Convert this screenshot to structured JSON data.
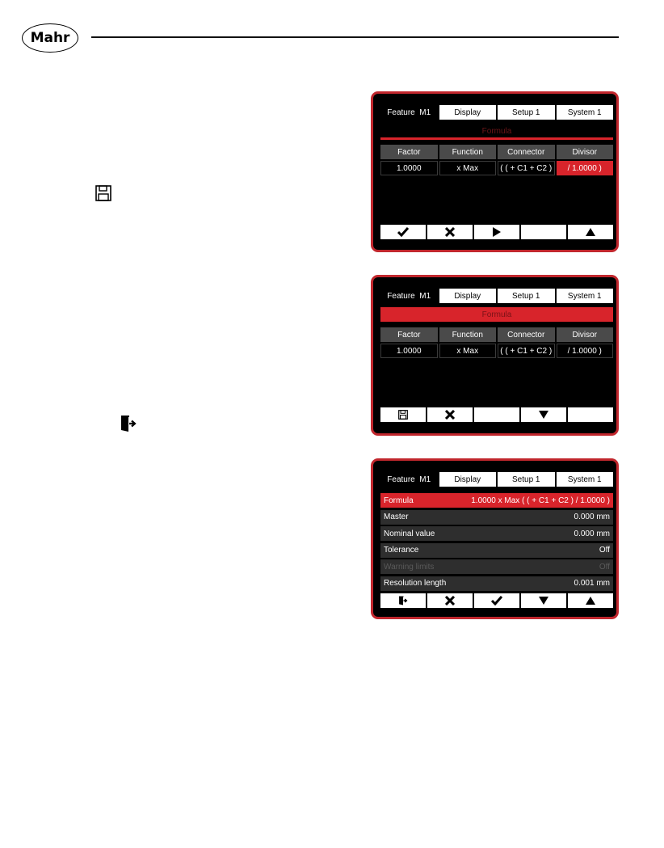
{
  "header": {
    "logo": "Mahr"
  },
  "side_icons": [
    "save-icon",
    "exit-icon"
  ],
  "screen1": {
    "tabs": [
      "Feature  M1",
      "Display",
      "Setup 1",
      "System 1"
    ],
    "formula_label": "Formula",
    "columns": [
      "Factor",
      "Function",
      "Connector",
      "Divisor"
    ],
    "values": [
      "1.0000",
      "x Max",
      "( ( + C1 + C2 )",
      "/ 1.0000 )"
    ],
    "buttons": [
      "check-icon",
      "close-icon",
      "play-icon",
      "",
      "triangle-up-icon"
    ]
  },
  "screen2": {
    "tabs": [
      "Feature  M1",
      "Display",
      "Setup 1",
      "System 1"
    ],
    "formula_label": "Formula",
    "columns": [
      "Factor",
      "Function",
      "Connector",
      "Divisor"
    ],
    "values": [
      "1.0000",
      "x Max",
      "( ( + C1 + C2 )",
      "/ 1.0000 )"
    ],
    "buttons": [
      "save-icon",
      "close-icon",
      "",
      "triangle-down-icon",
      ""
    ]
  },
  "screen3": {
    "tabs": [
      "Feature  M1",
      "Display",
      "Setup 1",
      "System 1"
    ],
    "rows": [
      {
        "label": "Formula",
        "value": "1.0000 x Max ( ( + C1 + C2 ) / 1.0000 )"
      },
      {
        "label": "Master",
        "value": "0.000 mm"
      },
      {
        "label": "Nominal value",
        "value": "0.000 mm"
      },
      {
        "label": "Tolerance",
        "value": "Off"
      },
      {
        "label": "Warning limits",
        "value": "Off"
      },
      {
        "label": "Resolution length",
        "value": "0.001 mm"
      }
    ],
    "buttons": [
      "exit-icon",
      "close-icon",
      "check-icon",
      "triangle-down-icon",
      "triangle-up-icon"
    ]
  },
  "colors": {
    "accent": "#d8242b",
    "frame": "#c1272d",
    "screen_bg": "#000000"
  }
}
